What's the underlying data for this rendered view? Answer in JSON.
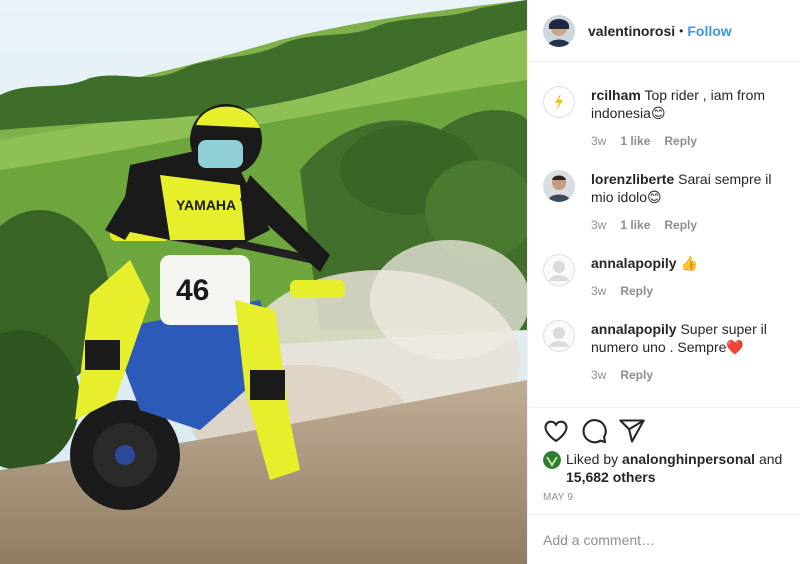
{
  "post": {
    "username": "valentinorosi",
    "separator": "•",
    "follow_label": "Follow"
  },
  "photo": {
    "alt_subject": "motocross rider on dirt track",
    "bike_number": "46",
    "brand_text": "YAMAHA",
    "colors": {
      "sky": "#dfeef6",
      "grass": "#5f9a3a",
      "dirt": "#a8957a",
      "suit_yellow": "#e7ef2c",
      "dark": "#1a1a1a"
    }
  },
  "comments": [
    {
      "username": "rcilham",
      "text": "Top rider , iam from indonesia😊",
      "time": "3w",
      "likes": "1 like",
      "reply": "Reply"
    },
    {
      "username": "lorenzliberte",
      "text": "Sarai sempre il mio idolo😊",
      "time": "3w",
      "likes": "1 like",
      "reply": "Reply"
    },
    {
      "username": "annalapopily",
      "text": "👍",
      "time": "3w",
      "reply": "Reply"
    },
    {
      "username": "annalapopily",
      "text": "Super super il numero uno . Sempre❤️",
      "time": "3w",
      "reply": "Reply"
    }
  ],
  "actions": {
    "like_icon": "heart-icon",
    "comment_icon": "comment-icon",
    "share_icon": "paper-plane-icon"
  },
  "likes": {
    "prefix": "Liked by",
    "user": "analonghinpersonal",
    "middle": "and",
    "count": "15,682 others"
  },
  "date": "MAY 9",
  "add_comment": {
    "placeholder": "Add a comment…"
  }
}
